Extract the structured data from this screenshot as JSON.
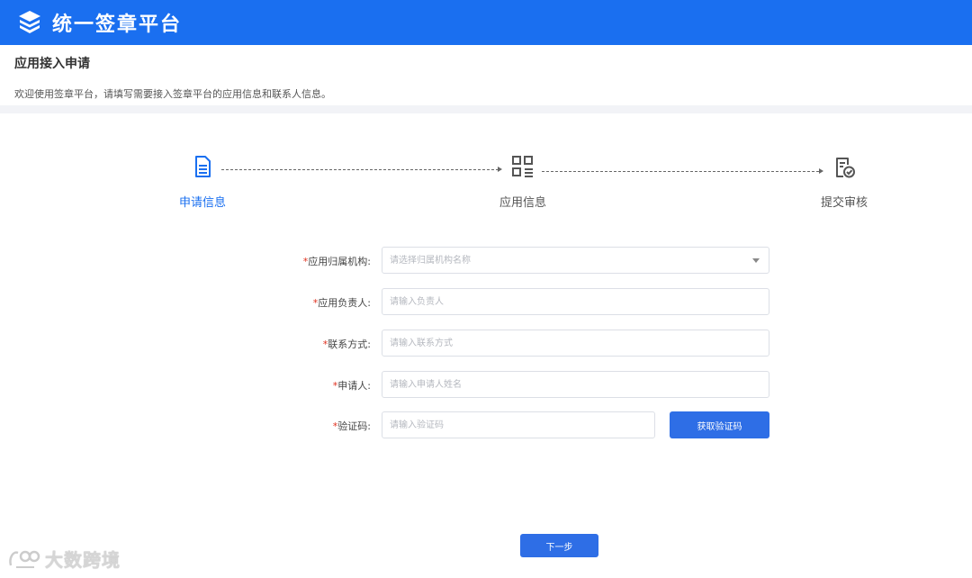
{
  "topbar": {
    "title": "统一签章平台",
    "logo_icon": "stacked-layers-logo-icon",
    "bg_color": "#1a6ff0"
  },
  "header": {
    "title": "应用接入申请",
    "subtitle": "欢迎使用签章平台，请填写需要接入签章平台的应用信息和联系人信息。"
  },
  "steps": [
    {
      "label": "申请信息",
      "icon": "document-icon",
      "active": true
    },
    {
      "label": "应用信息",
      "icon": "grid-list-icon",
      "active": false
    },
    {
      "label": "提交审核",
      "icon": "document-check-icon",
      "active": false
    }
  ],
  "form": {
    "org": {
      "label": "应用归属机构:",
      "placeholder": "请选择归属机构名称"
    },
    "owner": {
      "label": "应用负责人:",
      "placeholder": "请输入负责人"
    },
    "contact": {
      "label": "联系方式:",
      "placeholder": "请输入联系方式"
    },
    "applicant": {
      "label": "申请人:",
      "placeholder": "请输入申请人姓名"
    },
    "code": {
      "label": "验证码:",
      "placeholder": "请输入验证码",
      "button": "获取验证码"
    },
    "required_mark": "*"
  },
  "actions": {
    "next": "下一步"
  },
  "watermark": {
    "text": "大数跨境"
  },
  "colors": {
    "accent": "#2e6ee6",
    "required": "#e0301e"
  }
}
